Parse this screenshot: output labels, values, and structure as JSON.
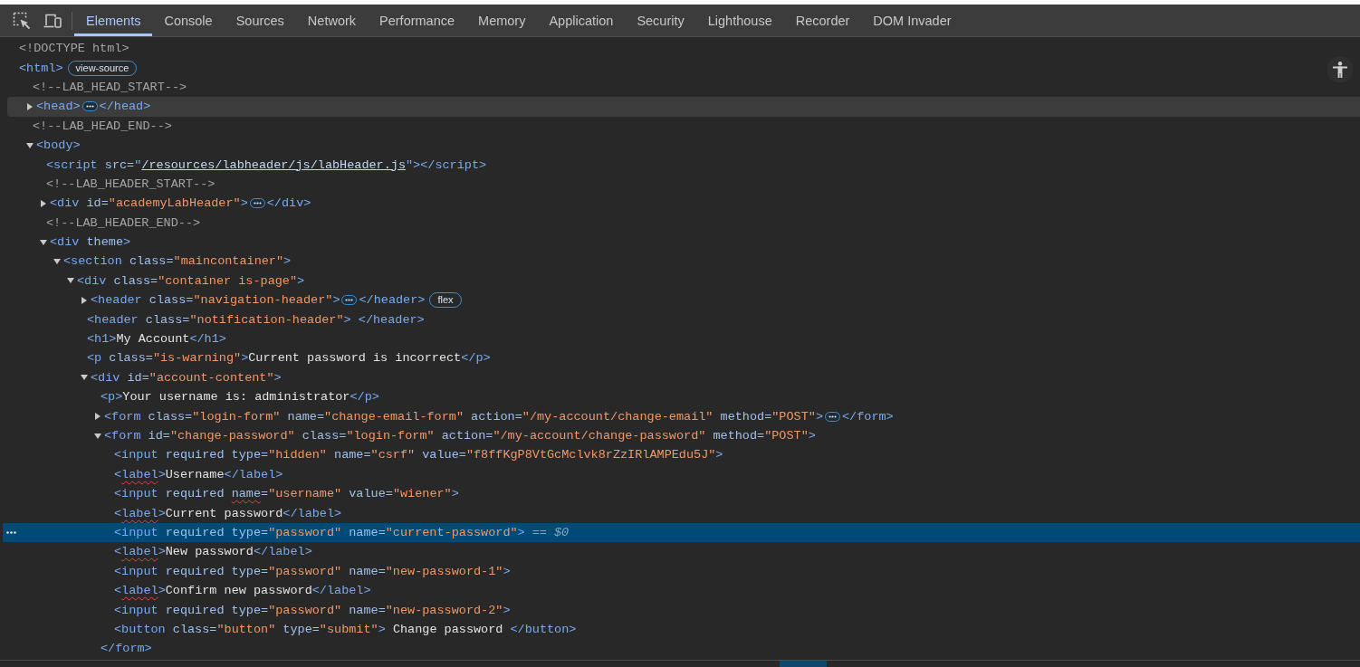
{
  "tabs": [
    {
      "label": "Elements",
      "selected": true
    },
    {
      "label": "Console",
      "selected": false
    },
    {
      "label": "Sources",
      "selected": false
    },
    {
      "label": "Network",
      "selected": false
    },
    {
      "label": "Performance",
      "selected": false
    },
    {
      "label": "Memory",
      "selected": false
    },
    {
      "label": "Application",
      "selected": false
    },
    {
      "label": "Security",
      "selected": false
    },
    {
      "label": "Lighthouse",
      "selected": false
    },
    {
      "label": "Recorder",
      "selected": false
    },
    {
      "label": "DOM Invader",
      "selected": false
    }
  ],
  "dom_tree": [
    {
      "tokens": [
        {
          "kind": "doctype",
          "text": "<!DOCTYPE html>"
        }
      ],
      "selected": false,
      "hovered": false
    },
    {
      "tokens": [
        {
          "kind": "tag",
          "text": "<html>"
        },
        {
          "kind": "badge",
          "text": "view-source"
        }
      ],
      "selected": false,
      "hovered": false,
      "children": [
        {
          "tokens": [
            {
              "kind": "comment",
              "text": "<!--LAB_HEAD_START-->"
            }
          ],
          "selected": false,
          "hovered": false
        },
        {
          "tokens": [
            {
              "kind": "tag",
              "text": "<head>"
            },
            {
              "kind": "ellipsis"
            },
            {
              "kind": "tag",
              "text": "</head>"
            }
          ],
          "expanded": false,
          "selected": false,
          "hovered": true
        },
        {
          "tokens": [
            {
              "kind": "comment",
              "text": "<!--LAB_HEAD_END-->"
            }
          ],
          "selected": false,
          "hovered": false
        },
        {
          "tokens": [
            {
              "kind": "tag",
              "text": "<body>"
            }
          ],
          "expanded": true,
          "selected": false,
          "hovered": false,
          "children": [
            {
              "tokens": [
                {
                  "kind": "tag",
                  "text": "<script"
                },
                {
                  "kind": "attr",
                  "text": " src="
                },
                {
                  "kind": "tag",
                  "text": "\""
                },
                {
                  "kind": "link",
                  "text": "/resources/labheader/js/labHeader.js"
                },
                {
                  "kind": "tag",
                  "text": "\"></script>"
                }
              ],
              "selected": false,
              "hovered": false
            },
            {
              "tokens": [
                {
                  "kind": "comment",
                  "text": "<!--LAB_HEADER_START-->"
                }
              ],
              "selected": false,
              "hovered": false
            },
            {
              "tokens": [
                {
                  "kind": "tag",
                  "text": "<div"
                },
                {
                  "kind": "attr",
                  "text": " id="
                },
                {
                  "kind": "value",
                  "text": "\"academyLabHeader\""
                },
                {
                  "kind": "tag",
                  "text": ">"
                },
                {
                  "kind": "ellipsis"
                },
                {
                  "kind": "tag",
                  "text": "</div>"
                }
              ],
              "expanded": false,
              "selected": false,
              "hovered": false
            },
            {
              "tokens": [
                {
                  "kind": "comment",
                  "text": "<!--LAB_HEADER_END-->"
                }
              ],
              "selected": false,
              "hovered": false
            },
            {
              "tokens": [
                {
                  "kind": "tag",
                  "text": "<div"
                },
                {
                  "kind": "attr",
                  "text": " theme"
                },
                {
                  "kind": "tag",
                  "text": ">"
                }
              ],
              "expanded": true,
              "selected": false,
              "hovered": false,
              "children": [
                {
                  "tokens": [
                    {
                      "kind": "tag",
                      "text": "<section"
                    },
                    {
                      "kind": "attr",
                      "text": " class="
                    },
                    {
                      "kind": "value",
                      "text": "\"maincontainer\""
                    },
                    {
                      "kind": "tag",
                      "text": ">"
                    }
                  ],
                  "expanded": true,
                  "selected": false,
                  "hovered": false,
                  "children": [
                    {
                      "tokens": [
                        {
                          "kind": "tag",
                          "text": "<div"
                        },
                        {
                          "kind": "attr",
                          "text": " class="
                        },
                        {
                          "kind": "value",
                          "text": "\"container is-page\""
                        },
                        {
                          "kind": "tag",
                          "text": ">"
                        }
                      ],
                      "expanded": true,
                      "selected": false,
                      "hovered": false,
                      "children": [
                        {
                          "tokens": [
                            {
                              "kind": "tag",
                              "text": "<header"
                            },
                            {
                              "kind": "attr",
                              "text": " class="
                            },
                            {
                              "kind": "value",
                              "text": "\"navigation-header\""
                            },
                            {
                              "kind": "tag",
                              "text": ">"
                            },
                            {
                              "kind": "ellipsis"
                            },
                            {
                              "kind": "tag",
                              "text": "</header>"
                            },
                            {
                              "kind": "badge",
                              "text": "flex"
                            }
                          ],
                          "expanded": false,
                          "selected": false,
                          "hovered": false
                        },
                        {
                          "tokens": [
                            {
                              "kind": "tag",
                              "text": "<header"
                            },
                            {
                              "kind": "attr",
                              "text": " class="
                            },
                            {
                              "kind": "value",
                              "text": "\"notification-header\""
                            },
                            {
                              "kind": "tag",
                              "text": "> </header>"
                            }
                          ],
                          "selected": false,
                          "hovered": false
                        },
                        {
                          "tokens": [
                            {
                              "kind": "tag",
                              "text": "<h1>"
                            },
                            {
                              "kind": "text",
                              "text": "My Account"
                            },
                            {
                              "kind": "tag",
                              "text": "</h1>"
                            }
                          ],
                          "selected": false,
                          "hovered": false
                        },
                        {
                          "tokens": [
                            {
                              "kind": "tag",
                              "text": "<p"
                            },
                            {
                              "kind": "attr",
                              "text": " class="
                            },
                            {
                              "kind": "value",
                              "text": "\"is-warning\""
                            },
                            {
                              "kind": "tag",
                              "text": ">"
                            },
                            {
                              "kind": "text",
                              "text": "Current password is incorrect"
                            },
                            {
                              "kind": "tag",
                              "text": "</p>"
                            }
                          ],
                          "selected": false,
                          "hovered": false
                        },
                        {
                          "tokens": [
                            {
                              "kind": "tag",
                              "text": "<div"
                            },
                            {
                              "kind": "attr",
                              "text": " id="
                            },
                            {
                              "kind": "value",
                              "text": "\"account-content\""
                            },
                            {
                              "kind": "tag",
                              "text": ">"
                            }
                          ],
                          "expanded": true,
                          "selected": false,
                          "hovered": false,
                          "children": [
                            {
                              "tokens": [
                                {
                                  "kind": "tag",
                                  "text": "<p>"
                                },
                                {
                                  "kind": "text",
                                  "text": "Your username is: administrator"
                                },
                                {
                                  "kind": "tag",
                                  "text": "</p>"
                                }
                              ],
                              "selected": false,
                              "hovered": false
                            },
                            {
                              "tokens": [
                                {
                                  "kind": "tag",
                                  "text": "<form"
                                },
                                {
                                  "kind": "attr",
                                  "text": " class="
                                },
                                {
                                  "kind": "value",
                                  "text": "\"login-form\""
                                },
                                {
                                  "kind": "attr",
                                  "text": " name="
                                },
                                {
                                  "kind": "value",
                                  "text": "\"change-email-form\""
                                },
                                {
                                  "kind": "attr",
                                  "text": " action="
                                },
                                {
                                  "kind": "value",
                                  "text": "\"/my-account/change-email\""
                                },
                                {
                                  "kind": "attr",
                                  "text": " method="
                                },
                                {
                                  "kind": "value",
                                  "text": "\"POST\""
                                },
                                {
                                  "kind": "tag",
                                  "text": ">"
                                },
                                {
                                  "kind": "ellipsis"
                                },
                                {
                                  "kind": "tag",
                                  "text": "</form>"
                                }
                              ],
                              "expanded": false,
                              "selected": false,
                              "hovered": false
                            },
                            {
                              "tokens": [
                                {
                                  "kind": "tag",
                                  "text": "<form"
                                },
                                {
                                  "kind": "attr",
                                  "text": " id="
                                },
                                {
                                  "kind": "value",
                                  "text": "\"change-password\""
                                },
                                {
                                  "kind": "attr",
                                  "text": " class="
                                },
                                {
                                  "kind": "value",
                                  "text": "\"login-form\""
                                },
                                {
                                  "kind": "attr",
                                  "text": " action="
                                },
                                {
                                  "kind": "value",
                                  "text": "\"/my-account/change-password\""
                                },
                                {
                                  "kind": "attr",
                                  "text": " method="
                                },
                                {
                                  "kind": "value",
                                  "text": "\"POST\""
                                },
                                {
                                  "kind": "tag",
                                  "text": ">"
                                }
                              ],
                              "expanded": true,
                              "selected": false,
                              "hovered": false,
                              "closing": [
                                {
                                  "kind": "tag",
                                  "text": "</form>"
                                }
                              ],
                              "children": [
                                {
                                  "tokens": [
                                    {
                                      "kind": "tag",
                                      "text": "<input"
                                    },
                                    {
                                      "kind": "attr",
                                      "text": " required type="
                                    },
                                    {
                                      "kind": "value",
                                      "text": "\"hidden\""
                                    },
                                    {
                                      "kind": "attr",
                                      "text": " name="
                                    },
                                    {
                                      "kind": "value",
                                      "text": "\"csrf\""
                                    },
                                    {
                                      "kind": "attr",
                                      "text": " value="
                                    },
                                    {
                                      "kind": "value",
                                      "text": "\"f8ffKgP8VtGcMclvk8rZzIRlAMPEdu5J\""
                                    },
                                    {
                                      "kind": "tag",
                                      "text": ">"
                                    }
                                  ],
                                  "selected": false,
                                  "hovered": false
                                },
                                {
                                  "tokens": [
                                    {
                                      "kind": "tag",
                                      "text": "<"
                                    },
                                    {
                                      "kind": "tag-misspelled",
                                      "text": "label"
                                    },
                                    {
                                      "kind": "tag",
                                      "text": ">"
                                    },
                                    {
                                      "kind": "text",
                                      "text": "Username"
                                    },
                                    {
                                      "kind": "tag",
                                      "text": "</label>"
                                    }
                                  ],
                                  "selected": false,
                                  "hovered": false
                                },
                                {
                                  "tokens": [
                                    {
                                      "kind": "tag",
                                      "text": "<input"
                                    },
                                    {
                                      "kind": "attr",
                                      "text": " required "
                                    },
                                    {
                                      "kind": "attr-misspelled",
                                      "text": "name"
                                    },
                                    {
                                      "kind": "attr",
                                      "text": "="
                                    },
                                    {
                                      "kind": "value",
                                      "text": "\"username\""
                                    },
                                    {
                                      "kind": "attr",
                                      "text": " value="
                                    },
                                    {
                                      "kind": "value",
                                      "text": "\"wiener\""
                                    },
                                    {
                                      "kind": "tag",
                                      "text": ">"
                                    }
                                  ],
                                  "selected": false,
                                  "hovered": false
                                },
                                {
                                  "tokens": [
                                    {
                                      "kind": "tag",
                                      "text": "<"
                                    },
                                    {
                                      "kind": "tag-misspelled",
                                      "text": "label"
                                    },
                                    {
                                      "kind": "tag",
                                      "text": ">"
                                    },
                                    {
                                      "kind": "text",
                                      "text": "Current password"
                                    },
                                    {
                                      "kind": "tag",
                                      "text": "</label>"
                                    }
                                  ],
                                  "selected": false,
                                  "hovered": false
                                },
                                {
                                  "tokens": [
                                    {
                                      "kind": "tag",
                                      "text": "<input"
                                    },
                                    {
                                      "kind": "attr",
                                      "text": " required type="
                                    },
                                    {
                                      "kind": "value",
                                      "text": "\"password\""
                                    },
                                    {
                                      "kind": "attr",
                                      "text": " name="
                                    },
                                    {
                                      "kind": "value",
                                      "text": "\"current-password\""
                                    },
                                    {
                                      "kind": "tag",
                                      "text": ">"
                                    },
                                    {
                                      "kind": "ref",
                                      "text": "== $0"
                                    }
                                  ],
                                  "selected": true,
                                  "hovered": false
                                },
                                {
                                  "tokens": [
                                    {
                                      "kind": "tag",
                                      "text": "<"
                                    },
                                    {
                                      "kind": "tag-misspelled",
                                      "text": "label"
                                    },
                                    {
                                      "kind": "tag",
                                      "text": ">"
                                    },
                                    {
                                      "kind": "text",
                                      "text": "New password"
                                    },
                                    {
                                      "kind": "tag",
                                      "text": "</label>"
                                    }
                                  ],
                                  "selected": false,
                                  "hovered": false
                                },
                                {
                                  "tokens": [
                                    {
                                      "kind": "tag",
                                      "text": "<input"
                                    },
                                    {
                                      "kind": "attr",
                                      "text": " required type="
                                    },
                                    {
                                      "kind": "value",
                                      "text": "\"password\""
                                    },
                                    {
                                      "kind": "attr",
                                      "text": " name="
                                    },
                                    {
                                      "kind": "value",
                                      "text": "\"new-password-1\""
                                    },
                                    {
                                      "kind": "tag",
                                      "text": ">"
                                    }
                                  ],
                                  "selected": false,
                                  "hovered": false
                                },
                                {
                                  "tokens": [
                                    {
                                      "kind": "tag",
                                      "text": "<"
                                    },
                                    {
                                      "kind": "tag-misspelled",
                                      "text": "label"
                                    },
                                    {
                                      "kind": "tag",
                                      "text": ">"
                                    },
                                    {
                                      "kind": "text",
                                      "text": "Confirm new password"
                                    },
                                    {
                                      "kind": "tag",
                                      "text": "</label>"
                                    }
                                  ],
                                  "selected": false,
                                  "hovered": false
                                },
                                {
                                  "tokens": [
                                    {
                                      "kind": "tag",
                                      "text": "<input"
                                    },
                                    {
                                      "kind": "attr",
                                      "text": " required type="
                                    },
                                    {
                                      "kind": "value",
                                      "text": "\"password\""
                                    },
                                    {
                                      "kind": "attr",
                                      "text": " name="
                                    },
                                    {
                                      "kind": "value",
                                      "text": "\"new-password-2\""
                                    },
                                    {
                                      "kind": "tag",
                                      "text": ">"
                                    }
                                  ],
                                  "selected": false,
                                  "hovered": false
                                },
                                {
                                  "tokens": [
                                    {
                                      "kind": "tag",
                                      "text": "<button"
                                    },
                                    {
                                      "kind": "attr",
                                      "text": " class="
                                    },
                                    {
                                      "kind": "value",
                                      "text": "\"button\""
                                    },
                                    {
                                      "kind": "attr",
                                      "text": " type="
                                    },
                                    {
                                      "kind": "value",
                                      "text": "\"submit\""
                                    },
                                    {
                                      "kind": "tag",
                                      "text": "> "
                                    },
                                    {
                                      "kind": "text",
                                      "text": "Change password"
                                    },
                                    {
                                      "kind": "tag",
                                      "text": " </button>"
                                    }
                                  ],
                                  "selected": false,
                                  "hovered": false
                                }
                              ]
                            }
                          ]
                        }
                      ]
                    }
                  ]
                }
              ]
            }
          ]
        }
      ]
    }
  ]
}
